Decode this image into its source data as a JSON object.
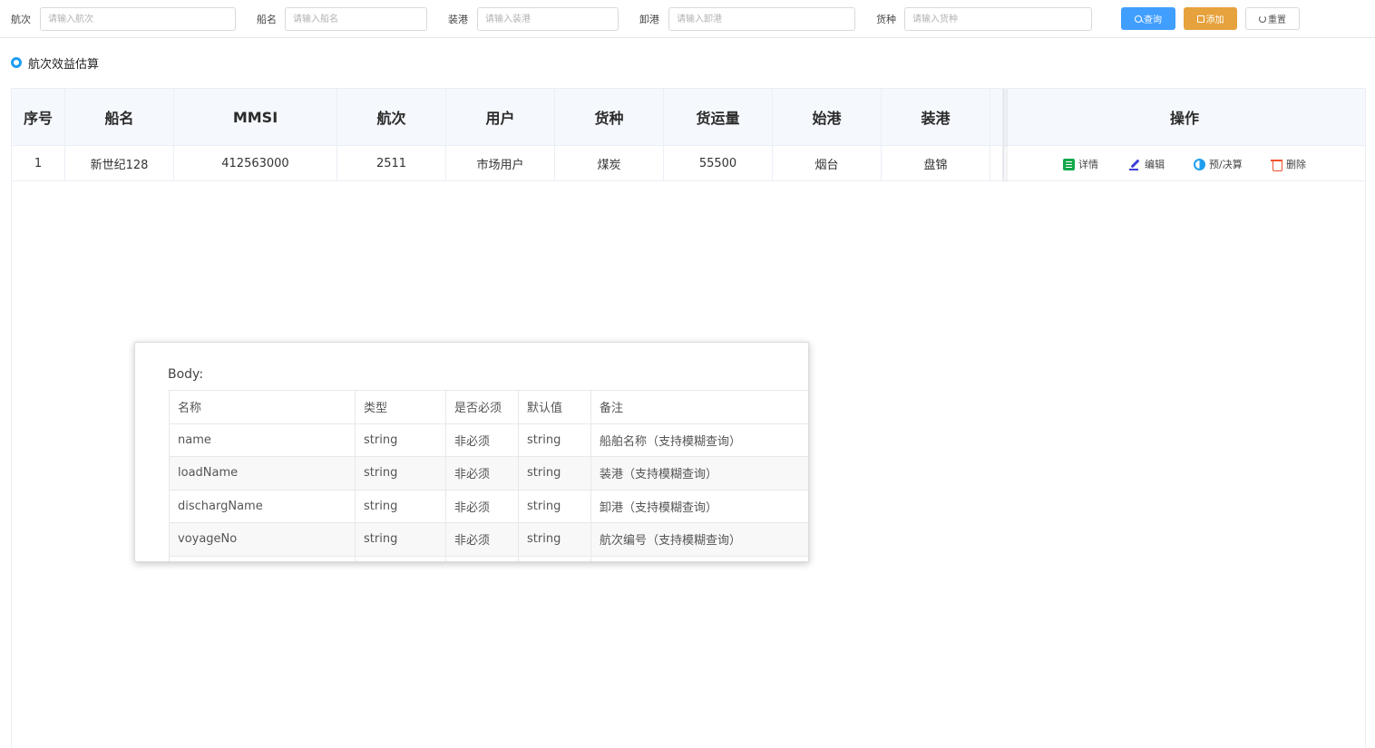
{
  "filters": {
    "voyage": {
      "label": "航次",
      "placeholder": "请输入航次"
    },
    "ship": {
      "label": "船名",
      "placeholder": "请输入船名"
    },
    "load_port": {
      "label": "装港",
      "placeholder": "请输入装港"
    },
    "discharge_port": {
      "label": "卸港",
      "placeholder": "请输入卸港"
    },
    "cargo": {
      "label": "货种",
      "placeholder": "请输入货种"
    }
  },
  "buttons": {
    "query": "查询",
    "add": "添加",
    "reset": "重置"
  },
  "section_title": "航次效益估算",
  "table": {
    "columns": [
      "序号",
      "船名",
      "MMSI",
      "航次",
      "用户",
      "货种",
      "货运量",
      "始港",
      "装港",
      "操作"
    ],
    "rows": [
      [
        "1",
        "新世纪128",
        "412563000",
        "2511",
        "市场用户",
        "煤炭",
        "55500",
        "烟台",
        "盘锦"
      ]
    ],
    "actions": [
      "详情",
      "编辑",
      "预/决算",
      "删除"
    ]
  },
  "popup": {
    "title": "Body:",
    "columns": [
      "名称",
      "类型",
      "是否必须",
      "默认值",
      "备注"
    ],
    "rows": [
      [
        "name",
        "string",
        "非必须",
        "string",
        "船舶名称（支持模糊查询）"
      ],
      [
        "loadName",
        "string",
        "非必须",
        "string",
        "装港（支持模糊查询）"
      ],
      [
        "dischargName",
        "string",
        "非必须",
        "string",
        "卸港（支持模糊查询）"
      ],
      [
        "voyageNo",
        "string",
        "非必须",
        "string",
        "航次编号（支持模糊查询）"
      ]
    ]
  },
  "colors": {
    "primary": "#409eff",
    "warning": "#e6a23c",
    "header_bg": "#f5f8fd",
    "accent_ring": "#1f9ef0"
  }
}
